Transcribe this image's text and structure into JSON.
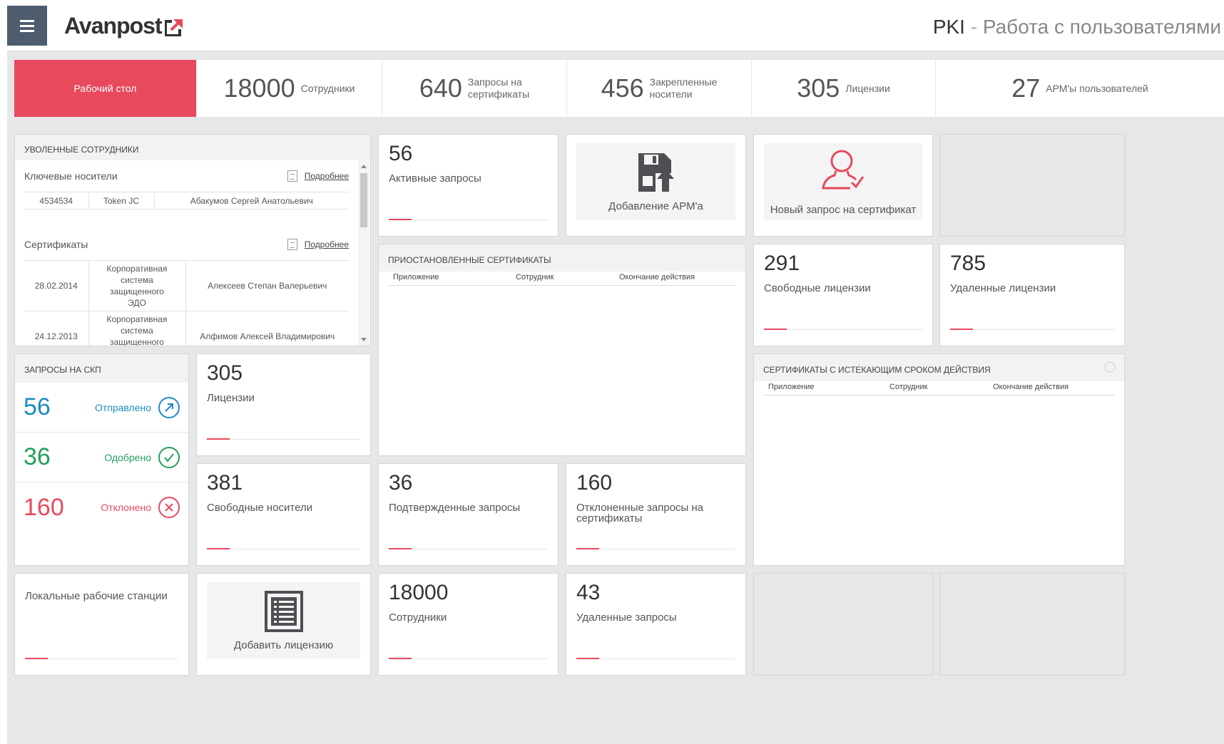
{
  "header": {
    "logo_text": "Avanpost",
    "title_main": "PKI",
    "title_sep": " - ",
    "title_sub": "Работа с пользователями"
  },
  "stats": [
    {
      "label": "Рабочий стол",
      "active": true
    },
    {
      "value": "18000",
      "label": "Сотрудники"
    },
    {
      "value": "640",
      "label_line1": "Запросы на",
      "label_line2": "сертификаты"
    },
    {
      "value": "456",
      "label_line1": "Закрепленные",
      "label_line2": "носители"
    },
    {
      "value": "305",
      "label": "Лицензии"
    },
    {
      "value": "27",
      "label": "АРМ'ы пользователей"
    }
  ],
  "fired": {
    "title": "Уволенные сотрудники",
    "keys_label": "Ключевые носители",
    "certs_label": "Сертификаты",
    "more_label": "Подробнее",
    "keys_rows": [
      [
        "4534534",
        "Token JC",
        "Абакумов Сергей Анатольевич"
      ]
    ],
    "cert_rows": [
      [
        "28.02.2014",
        "Корпоративная система защищенного ЭДО",
        "Алексеев Степан Валерьевич"
      ],
      [
        "24.12.2013",
        "Корпоративная система защищенного ЭДО",
        "Алфимов Алексей Владимирович"
      ]
    ]
  },
  "tiles": {
    "active_requests": {
      "value": "56",
      "label": "Активные запросы"
    },
    "add_arm": {
      "label": "Добавление АРМ'a",
      "icon": "floppy-upload-icon"
    },
    "new_cert_request": {
      "label": "Новый запрос на сертификат",
      "icon": "user-check-icon"
    },
    "free_licenses": {
      "value": "291",
      "label": "Свободные лицензии"
    },
    "deleted_licenses": {
      "value": "785",
      "label": "Удаленные лицензии"
    },
    "licenses": {
      "value": "305",
      "label": "Лицензии"
    },
    "free_media": {
      "value": "381",
      "label": "Свободные носители"
    },
    "confirmed_requests": {
      "value": "36",
      "label": "Подтвержденные запросы"
    },
    "rejected_requests": {
      "value": "160",
      "label": "Отклоненные запросы на сертификаты"
    },
    "local_workstations": {
      "label": "Локальные рабочие станции"
    },
    "add_license": {
      "label": "Добавить лицензию",
      "icon": "list-document-icon"
    },
    "employees": {
      "value": "18000",
      "label": "Сотрудники"
    },
    "deleted_requests": {
      "value": "43",
      "label": "Удаленные запросы"
    }
  },
  "suspended": {
    "title": "Приостановленные сертификаты",
    "columns": [
      "Приложение",
      "Сотрудник",
      "Окончание действия"
    ]
  },
  "expiring": {
    "title": "Сертификаты с истекающим сроком действия",
    "columns": [
      "Приложение",
      "Сотрудник",
      "Окончание действия"
    ]
  },
  "requests_skp": {
    "title": "Запросы на СКП",
    "items": [
      {
        "value": "56",
        "label": "Отправлено",
        "color": "#1e8bc3",
        "icon": "arrow-up-right-icon"
      },
      {
        "value": "36",
        "label": "Одобрено",
        "color": "#23a05c",
        "icon": "check-circle-icon"
      },
      {
        "value": "160",
        "label": "Отклонено",
        "color": "#e8495d",
        "icon": "x-circle-icon"
      }
    ]
  },
  "colors": {
    "accent": "#e8495d",
    "menu": "#4d5d6d"
  }
}
